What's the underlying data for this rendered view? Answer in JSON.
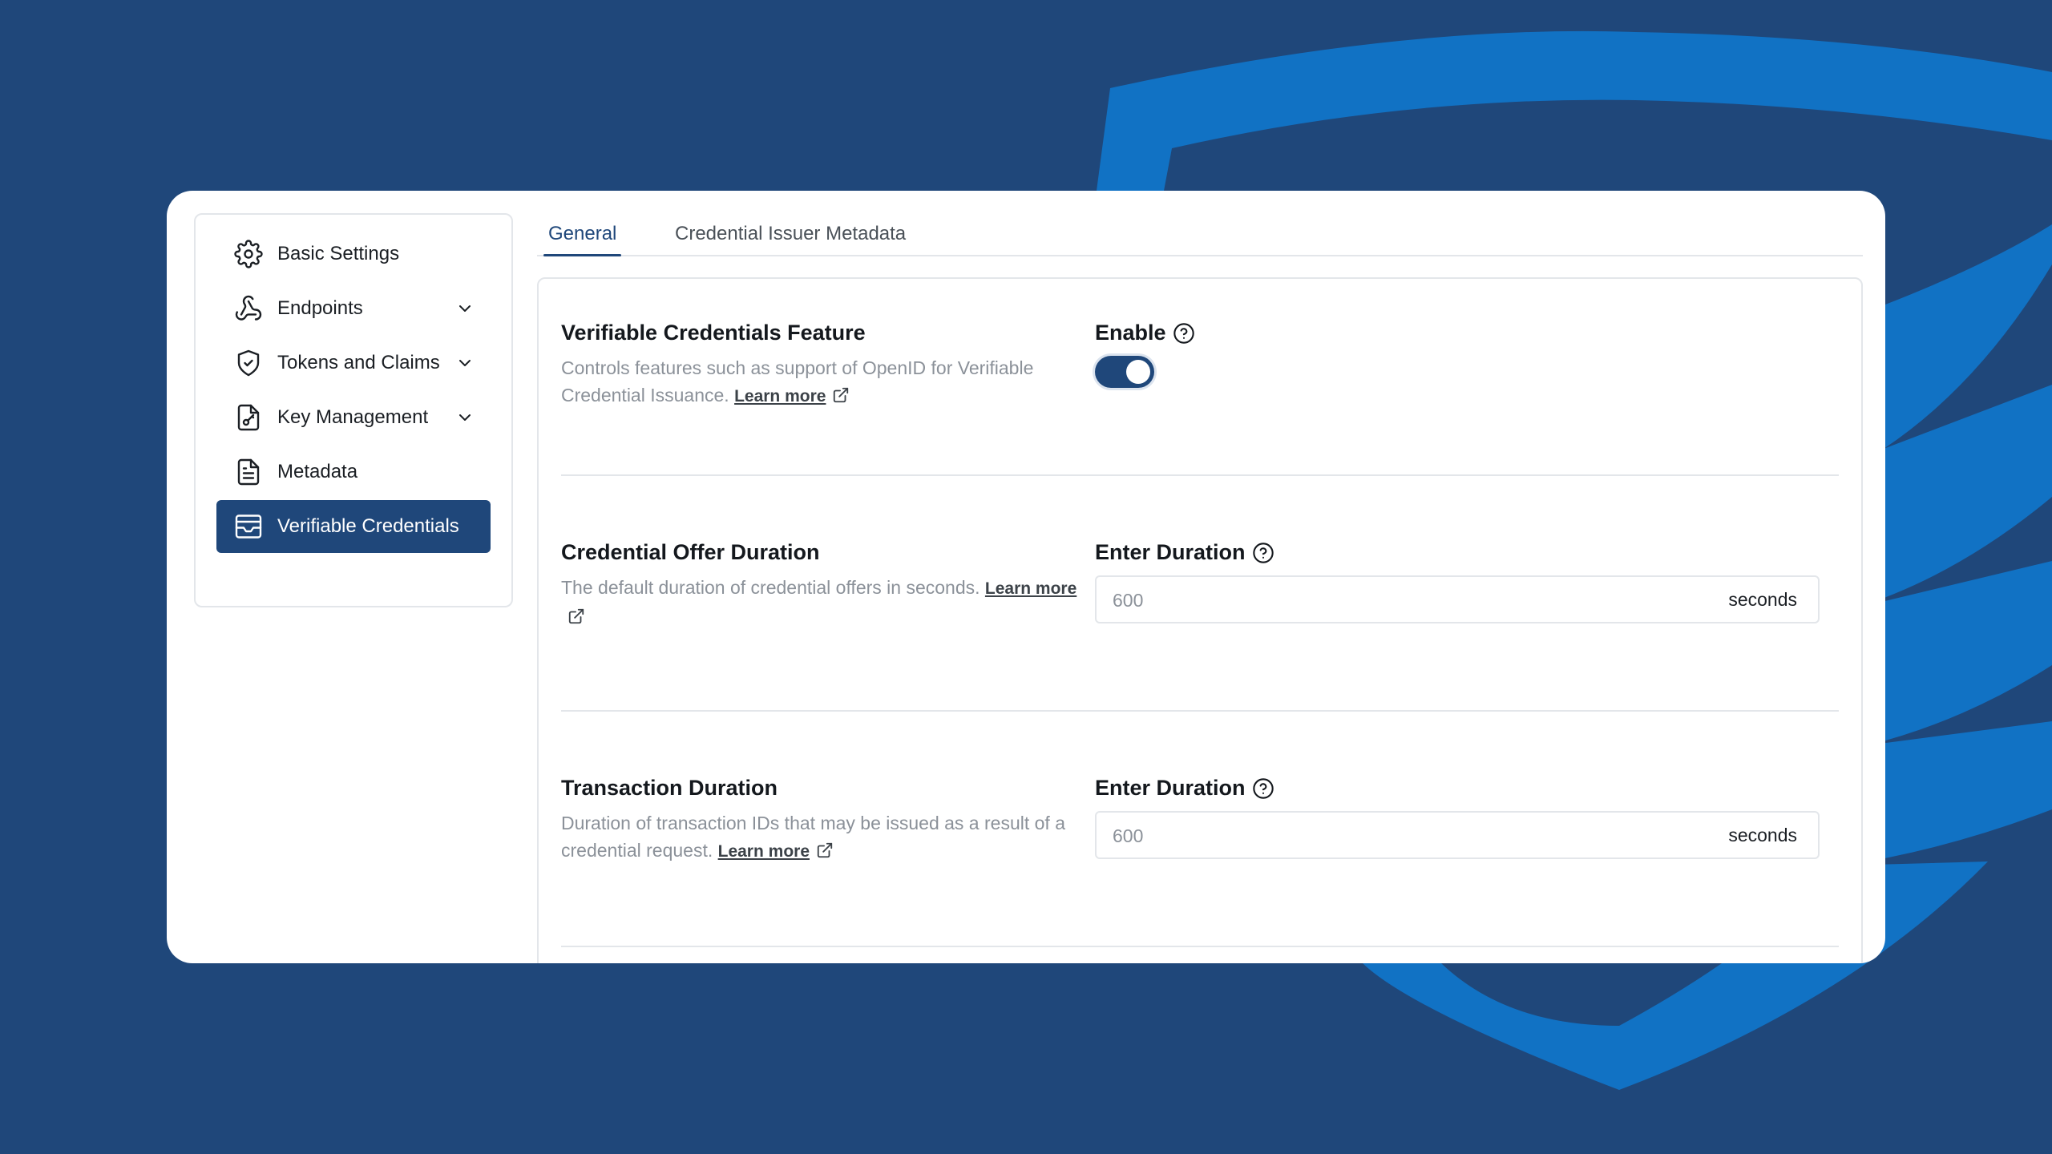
{
  "sidebar": {
    "items": [
      {
        "label": "Basic Settings"
      },
      {
        "label": "Endpoints"
      },
      {
        "label": "Tokens and Claims"
      },
      {
        "label": "Key Management"
      },
      {
        "label": "Metadata"
      },
      {
        "label": "Verifiable Credentials"
      }
    ]
  },
  "tabs": [
    {
      "label": "General"
    },
    {
      "label": "Credential Issuer Metadata"
    }
  ],
  "sections": {
    "feature": {
      "title": "Verifiable Credentials Feature",
      "description": "Controls features such as support of OpenID for Verifiable Credential Issuance.",
      "link": "Learn more",
      "field_label": "Enable"
    },
    "offer": {
      "title": "Credential Offer Duration",
      "description": "The default duration of credential offers in seconds.",
      "link": "Learn more",
      "field_label": "Enter Duration",
      "placeholder": "600",
      "suffix": "seconds"
    },
    "transaction": {
      "title": "Transaction Duration",
      "description": "Duration of transaction IDs that may be issued as a result of a credential request.",
      "link": "Learn more",
      "field_label": "Enter Duration",
      "placeholder": "600",
      "suffix": "seconds"
    }
  },
  "colors": {
    "background": "#1f477a",
    "accent": "#1f477a",
    "shape": "#1172c4"
  },
  "icons": [
    "gear-icon",
    "webhook-icon",
    "shield-check-icon",
    "file-key-icon",
    "file-text-icon",
    "credential-card-icon",
    "chevron-down-icon",
    "help-circle-icon",
    "external-link-icon"
  ]
}
